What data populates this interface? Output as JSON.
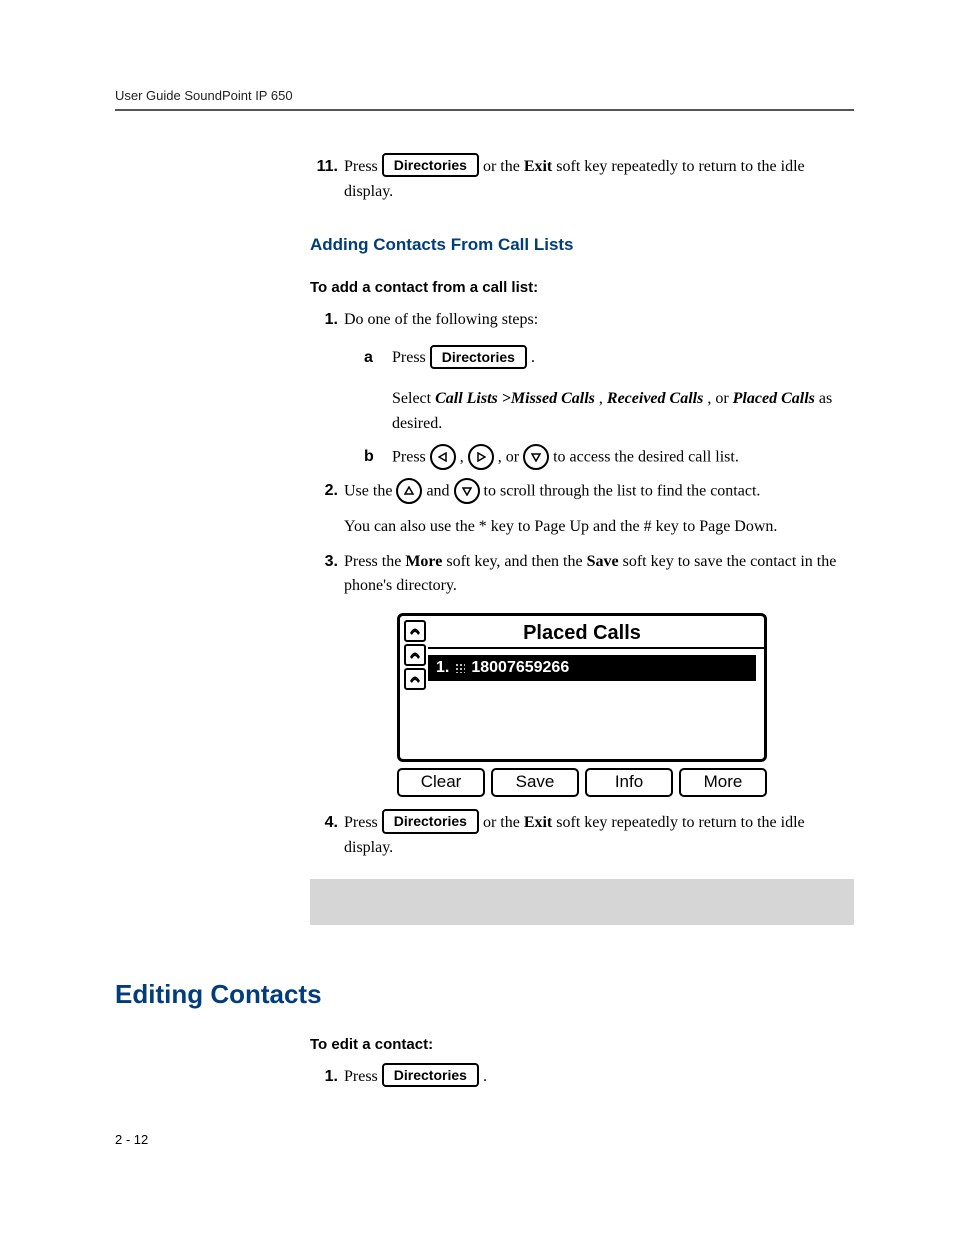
{
  "header": "User Guide SoundPoint IP 650",
  "page_number": "2 - 12",
  "buttons": {
    "directories": "Directories"
  },
  "softkey_names": {
    "exit": "Exit",
    "more": "More",
    "save": "Save"
  },
  "section11": {
    "num": "11.",
    "pre": "Press ",
    "post_a": " or the ",
    "post_b": " soft key repeatedly to return to the idle display."
  },
  "heading_add": "Adding Contacts From Call Lists",
  "task_add": "To add a contact from a call list:",
  "step1": {
    "num": "1.",
    "text": "Do one of the following steps:",
    "a": {
      "letter": "a",
      "pre": "Press ",
      "post": " .",
      "line2a": "Select ",
      "path": "Call Lists >Missed Calls",
      "comma": ", ",
      "rc": "Received Calls",
      "or": ", or ",
      "pc": "Placed Calls",
      "tail": " as desired."
    },
    "b": {
      "letter": "b",
      "pre": "Press ",
      "mid1": " , ",
      "mid2": " , or ",
      "post": "  to access the desired call list."
    }
  },
  "step2": {
    "num": "2.",
    "pre": "Use the ",
    "mid": " and ",
    "post": " to scroll through the list to find the contact.",
    "line2": "You can also use the * key to Page Up and the # key to Page Down."
  },
  "step3": {
    "num": "3.",
    "a": "Press the ",
    "b": " soft key, and then the ",
    "c": " soft key to save the contact in the phone's directory."
  },
  "screenshot": {
    "title": "Placed Calls",
    "row": "1.    18007659266",
    "keys": [
      "Clear",
      "Save",
      "Info",
      "More"
    ]
  },
  "step4": {
    "num": "4.",
    "pre": "Press ",
    "post_a": " or the ",
    "post_b": " soft key repeatedly to return to the idle display."
  },
  "heading_edit": "Editing Contacts",
  "task_edit": "To edit a contact:",
  "edit_step1": {
    "num": "1.",
    "pre": "Press ",
    "post": " ."
  }
}
